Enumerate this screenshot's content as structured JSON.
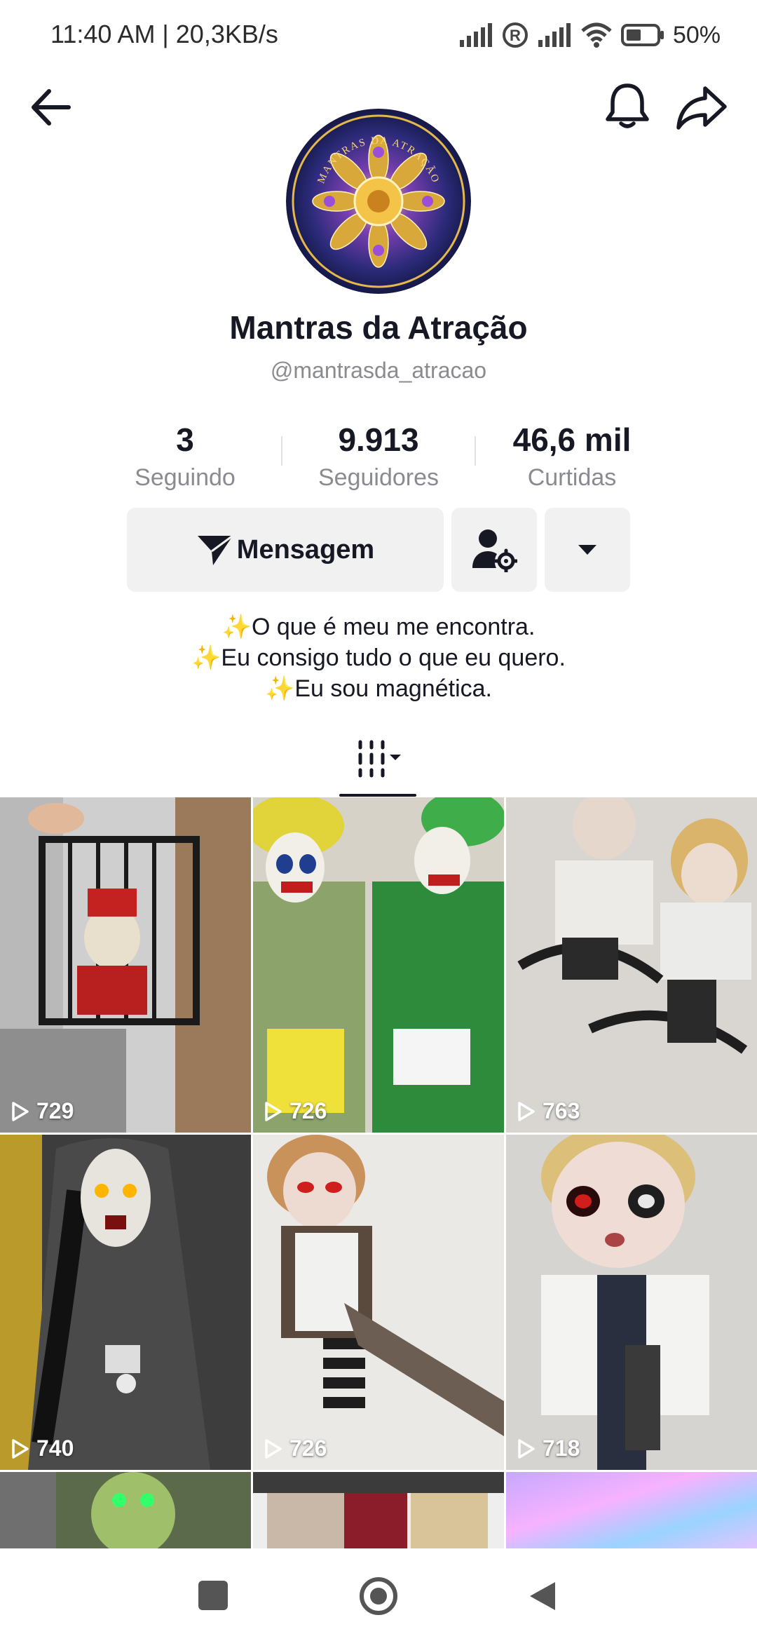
{
  "status_bar": {
    "time": "11:40 AM | 20,3KB/s",
    "battery": "50%"
  },
  "header": {
    "back_icon": "arrow-left-icon",
    "bell_icon": "bell-icon",
    "share_icon": "share-icon"
  },
  "avatar": {
    "text": "MANTRAS DA ATRAÇÃO"
  },
  "profile": {
    "name": "Mantras da Atração",
    "handle": "@mantrasda_atracao"
  },
  "stats": {
    "following": {
      "value": "3",
      "label": "Seguindo"
    },
    "followers": {
      "value": "9.913",
      "label": "Seguidores"
    },
    "likes": {
      "value": "46,6 mil",
      "label": "Curtidas"
    }
  },
  "actions": {
    "message_label": "Mensagem"
  },
  "bio": {
    "lines": [
      "O que é meu me encontra.",
      "Eu consigo tudo o que eu quero.",
      "Eu sou magnética."
    ],
    "sparkle": "✨"
  },
  "videos": [
    {
      "views": "729"
    },
    {
      "views": "726"
    },
    {
      "views": "763"
    },
    {
      "views": "740"
    },
    {
      "views": "726"
    },
    {
      "views": "718"
    }
  ],
  "colors": {
    "text": "#161823",
    "secondary": "#8a8b91",
    "button_bg": "#f1f1f2"
  }
}
